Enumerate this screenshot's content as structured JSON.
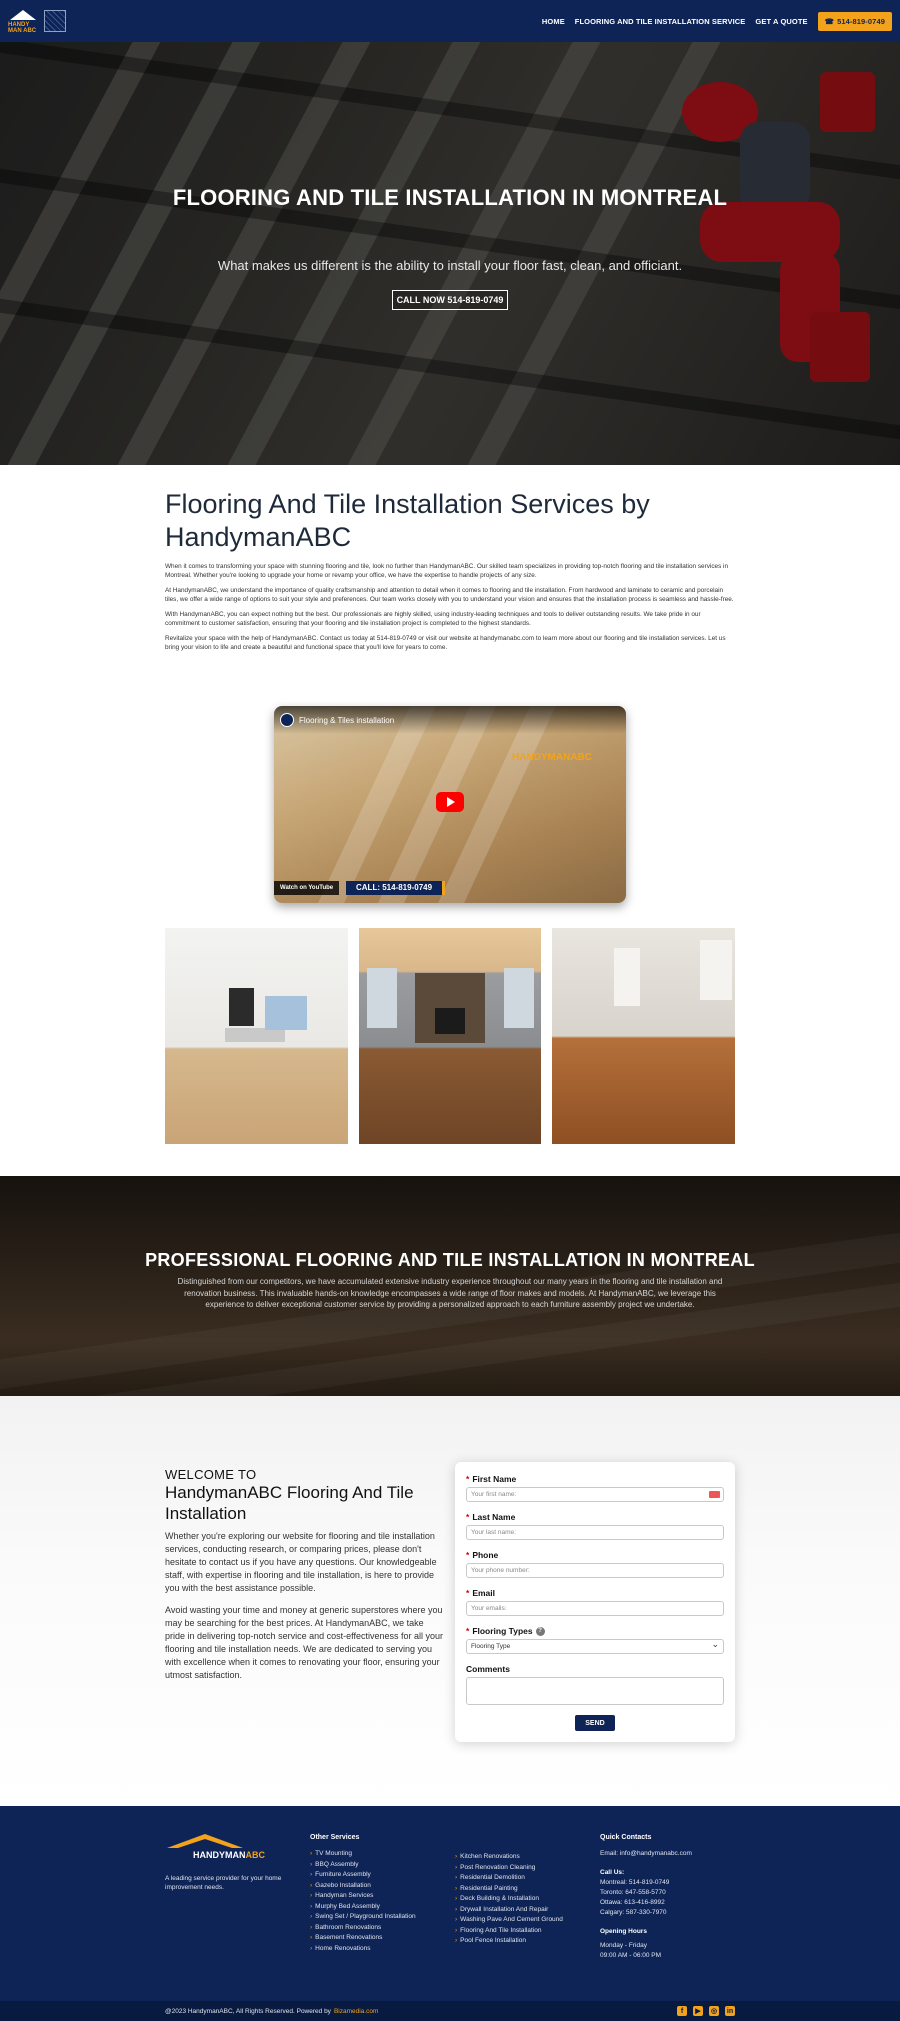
{
  "header": {
    "logo_text": "HANDY MAN ABC",
    "nav": [
      "HOME",
      "FLOORING AND TILE INSTALLATION SERVICE",
      "GET A QUOTE"
    ],
    "call_label": "514-819-0749",
    "accent": "#f2a31b",
    "brand": "#0e2456"
  },
  "hero": {
    "title": "FLOORING AND TILE INSTALLATION IN MONTREAL",
    "subtitle": "What makes us different is the ability to install your floor fast, clean, and officiant.",
    "button": "CALL NOW 514-819-0749"
  },
  "intro": {
    "heading": "Flooring And Tile Installation Services by HandymanABC",
    "paragraphs": [
      "When it comes to transforming your space with stunning flooring and tile, look no further than HandymanABC. Our skilled team specializes in providing top-notch flooring and tile installation services in Montreal. Whether you're looking to upgrade your home or revamp your office, we have the expertise to handle projects of any size.",
      "At HandymanABC, we understand the importance of quality craftsmanship and attention to detail when it comes to flooring and tile installation. From hardwood and laminate to ceramic and porcelain tiles, we offer a wide range of options to suit your style and preferences. Our team works closely with you to understand your vision and ensures that the installation process is seamless and hassle-free.",
      "With HandymanABC, you can expect nothing but the best. Our professionals are highly skilled, using industry-leading techniques and tools to deliver outstanding results. We take pride in our commitment to customer satisfaction, ensuring that your flooring and tile installation project is completed to the highest standards.",
      "Revitalize your space with the help of HandymanABC. Contact us today at 514-819-0749 or visit our website at handymanabc.com to learn more about our flooring and tile installation services. Let us bring your vision to life and create a beautiful and functional space that you'll love for years to come."
    ]
  },
  "video": {
    "title": "Flooring & Tiles installation",
    "watch_on": "Watch on",
    "youtube": "YouTube",
    "call": "CALL: 514-819-0749",
    "brand_mark": "HANDYMANABC"
  },
  "gallery": {
    "images": [
      "kitchen-image",
      "living-room-fireplace-image",
      "empty-room-hardwood-image"
    ]
  },
  "professional": {
    "title": "PROFESSIONAL FLOORING AND TILE INSTALLATION IN MONTREAL",
    "text": "Distinguished from our competitors, we have accumulated extensive industry experience throughout our many years in the flooring and tile installation and renovation business. This invaluable hands-on knowledge encompasses a wide range of floor makes and models. At HandymanABC, we leverage this experience to deliver exceptional customer service by providing a personalized approach to each furniture assembly project we undertake."
  },
  "welcome": {
    "kicker": "WELCOME TO",
    "title": "HandymanABC Flooring And Tile Installation",
    "p1": "Whether you're exploring our website for flooring and tile installation services, conducting research, or comparing prices, please don't hesitate to contact us if you have any questions. Our knowledgeable staff, with expertise in flooring and tile installation, is here to provide you with the best assistance possible.",
    "p2": "Avoid wasting your time and money at generic superstores where you may be searching for the best prices. At HandymanABC, we take pride in delivering top-notch service and cost-effectiveness for all your flooring and tile installation needs. We are dedicated to serving you with excellence when it comes to renovating your floor, ensuring your utmost satisfaction."
  },
  "form": {
    "req": "*",
    "first_name_label": "First Name",
    "first_name_placeholder": "Your first name:",
    "last_name_label": "Last Name",
    "last_name_placeholder": "Your last name:",
    "phone_label": "Phone",
    "phone_placeholder": "Your phone number:",
    "email_label": "Email",
    "email_placeholder": "Your emails:",
    "types_label": "Flooring Types",
    "types_info": "?",
    "types_value": "Flooring Type",
    "comments_label": "Comments",
    "send": "SEND"
  },
  "footer": {
    "logo_name": "HANDYMAN",
    "logo_accent": "ABC",
    "tagline": "A leading service provider for your home improvement needs.",
    "other_services_title": "Other Services",
    "services_col1": [
      "TV Mounting",
      "BBQ Assembly",
      "Furniture Assembly",
      "Gazebo Installation",
      "Handyman Services",
      "Murphy Bed Assembly",
      "Swing Set / Playground Installation",
      "Bathroom Renovations",
      "Basement Renovations",
      "Home Renovations"
    ],
    "services_col2": [
      "Kitchen Renovations",
      "Post Renovation Cleaning",
      "Residential Demolition",
      "Residential Painting",
      "Deck Building & Installation",
      "Drywall Installation And Repair",
      "Washing Pave And Cement Ground",
      "Flooring And Tile Installation",
      "Pool Fence Installation"
    ],
    "quick_title": "Quick Contacts",
    "email": "Email: info@handymanabc.com",
    "call_us": "Call Us:",
    "phones": [
      "Montreal: 514-819-0749",
      "Toronto: 647-558-5770",
      "Ottawa: 613-416-8992",
      "Calgary: 587-330-7970"
    ],
    "hours_title": "Opening Hours",
    "days": "Monday - Friday",
    "hours": "09:00 AM - 06:00 PM"
  },
  "bottom": {
    "copyright": "@2023 HandymanABC, All Rights Reserved. Powered by",
    "powered": "Bizamedia.com",
    "social_icons": [
      "facebook-icon",
      "youtube-icon",
      "instagram-icon",
      "linkedin-icon"
    ]
  }
}
